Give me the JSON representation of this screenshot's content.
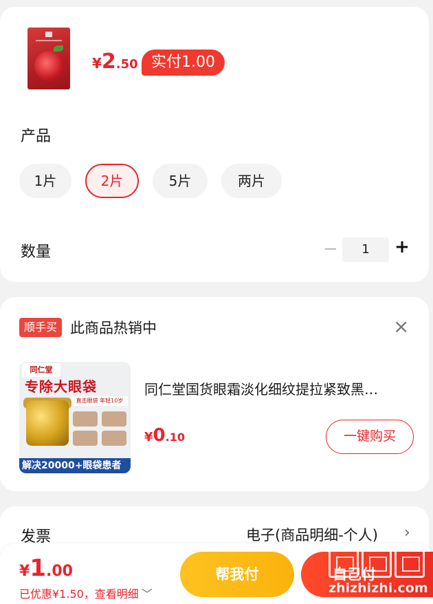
{
  "product": {
    "price": {
      "currency": "¥",
      "integer": "2",
      "decimal": ".50"
    },
    "paid_badge": "实付1.00"
  },
  "spec": {
    "label": "产品",
    "options": [
      "1片",
      "2片",
      "5片",
      "两片"
    ],
    "selected": "2片"
  },
  "quantity": {
    "label": "数量",
    "minus": "−",
    "value": "1",
    "plus": "+"
  },
  "recommend": {
    "tag": "顺手买",
    "heading": "此商品热销中",
    "close": "×",
    "image": {
      "brand": "同仁堂",
      "headline": "专除大眼袋",
      "subline": "直击眼袋 年轻10岁",
      "bottom": "解决20000+眼袋患者"
    },
    "title": "同仁堂国货眼霜淡化细纹提拉紧致黑…",
    "price": {
      "currency": "¥",
      "integer": "0",
      "decimal": ".10"
    },
    "buy_button": "一键购买"
  },
  "invoice": {
    "label": "发票",
    "value": "电子(商品明细-个人)",
    "arrow": "›"
  },
  "checkout": {
    "total": {
      "currency": "¥",
      "integer": "1",
      "decimal": ".00"
    },
    "discount_text": "已优惠¥1.50，查看明细",
    "discount_chevron": "﹀",
    "help_pay": "帮我付",
    "self_pay": "自己付"
  },
  "watermark": {
    "url": "zhizhizhi.com"
  },
  "colors": {
    "accent": "#e8242b",
    "help": "#fbb30c",
    "self": "#ee2a22"
  }
}
